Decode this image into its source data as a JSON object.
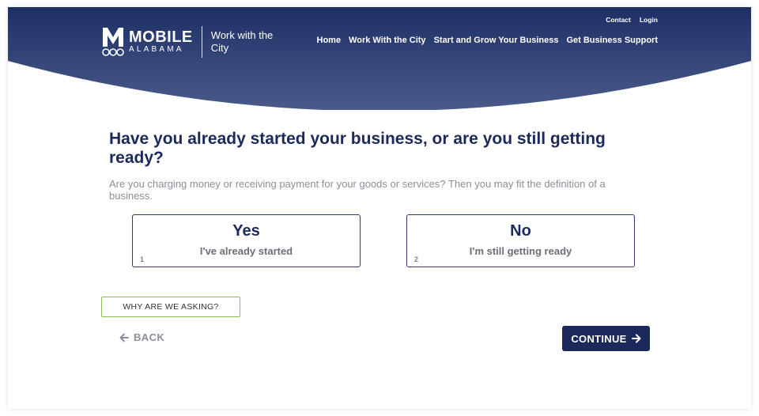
{
  "colors": {
    "header_dark": "#1e2f66",
    "header_light": "#4a5b8a",
    "primary": "#1b2a5a",
    "muted_text": "#8a8f99",
    "accent_green": "#8cc152"
  },
  "brand": {
    "name": "MOBILE",
    "state": "ALABAMA",
    "tagline": "Work with the City",
    "icon": "mobile-m-logo-icon"
  },
  "top_links": [
    "Contact",
    "Login"
  ],
  "nav": [
    "Home",
    "Work With the City",
    "Start and Grow Your Business",
    "Get Business Support"
  ],
  "question": {
    "title": "Have you already started your business, or are you still getting ready?",
    "explanation": "Are you charging money or receiving payment for your goods or services? Then you may fit the definition of a business."
  },
  "options": [
    {
      "title": "Yes",
      "subtitle": "I've already started",
      "number": "1"
    },
    {
      "title": "No",
      "subtitle": "I'm still getting ready",
      "number": "2"
    }
  ],
  "actions": {
    "why": "WHY ARE WE ASKING?",
    "back": "BACK",
    "continue": "CONTINUE",
    "back_icon": "arrow-left-icon",
    "continue_icon": "arrow-right-icon"
  }
}
